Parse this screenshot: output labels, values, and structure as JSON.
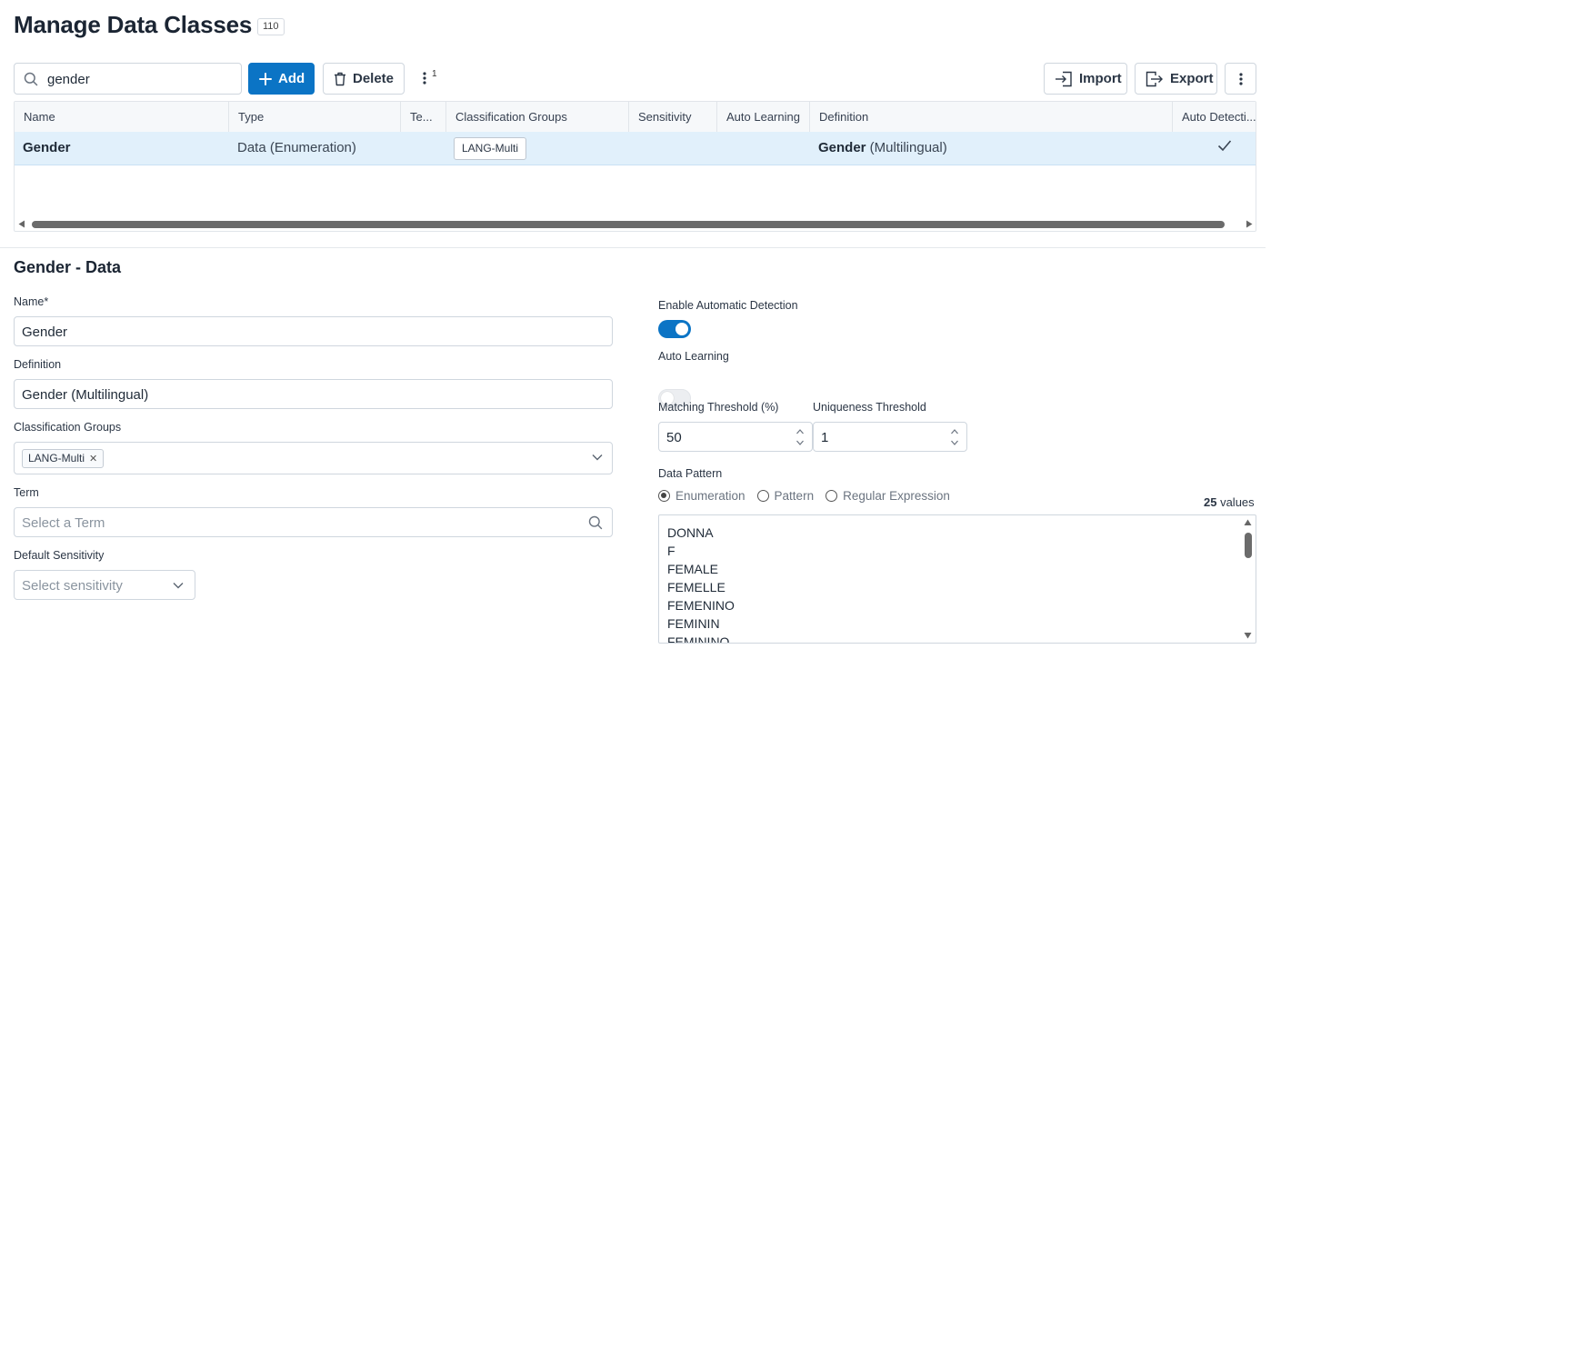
{
  "header": {
    "title": "Manage Data Classes",
    "count": "110"
  },
  "toolbar": {
    "search_value": "gender",
    "add_label": "Add",
    "delete_label": "Delete",
    "more_count": "1",
    "import_label": "Import",
    "export_label": "Export"
  },
  "table": {
    "columns": [
      "Name",
      "Type",
      "Te...",
      "Classification Groups",
      "Sensitivity",
      "Auto Learning",
      "Definition",
      "Auto Detecti..."
    ],
    "rows": [
      {
        "name": "Gender",
        "type": "Data (Enumeration)",
        "term": "",
        "classification_group": "LANG-Multi",
        "sensitivity": "",
        "auto_learning": "",
        "definition_bold": "Gender",
        "definition_rest": " (Multilingual)",
        "auto_detection": true
      }
    ]
  },
  "detail": {
    "title": "Gender - Data",
    "name_label": "Name*",
    "name_value": "Gender",
    "definition_label": "Definition",
    "definition_value": "Gender (Multilingual)",
    "classification_groups_label": "Classification Groups",
    "classification_groups_tags": [
      "LANG-Multi"
    ],
    "term_label": "Term",
    "term_placeholder": "Select a Term",
    "default_sensitivity_label": "Default Sensitivity",
    "sensitivity_placeholder": "Select sensitivity",
    "enable_auto_detection_label": "Enable Automatic Detection",
    "enable_auto_detection": true,
    "auto_learning_label": "Auto Learning",
    "auto_learning": false,
    "matching_threshold_label": "Matching Threshold (%)",
    "matching_threshold_value": "50",
    "uniqueness_threshold_label": "Uniqueness Threshold",
    "uniqueness_threshold_value": "1",
    "data_pattern_label": "Data Pattern",
    "data_pattern_options": [
      "Enumeration",
      "Pattern",
      "Regular Expression"
    ],
    "data_pattern_selected": "Enumeration",
    "values_count": "25",
    "values_suffix": " values",
    "values": [
      "DONNA",
      "F",
      "FEMALE",
      "FEMELLE",
      "FEMENINO",
      "FEMININ",
      "FEMININO"
    ]
  },
  "colors": {
    "accent": "#0b74c5",
    "selected_row": "#e1f0fb"
  }
}
